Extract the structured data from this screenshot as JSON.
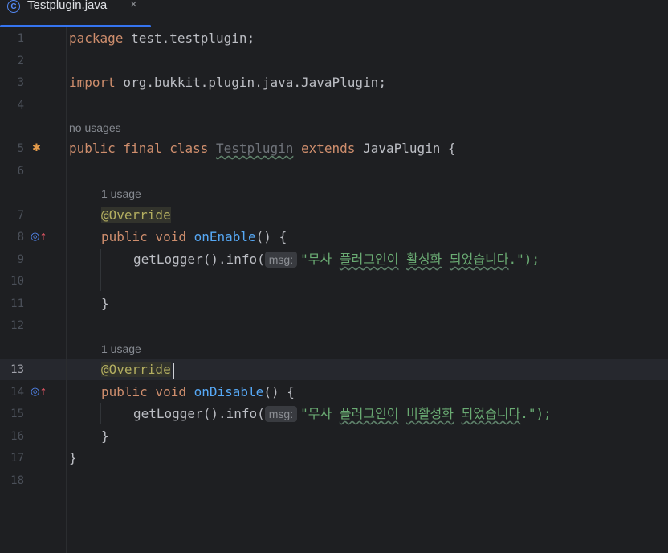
{
  "tab": {
    "icon": "class-icon",
    "icon_letter": "C",
    "label": "Testplugin.java",
    "close": "×"
  },
  "line_numbers": [
    "1",
    "2",
    "3",
    "4",
    "5",
    "6",
    "7",
    "8",
    "9",
    "10",
    "11",
    "12",
    "13",
    "14",
    "15",
    "16",
    "17",
    "18"
  ],
  "active_line": "13",
  "hints": {
    "no_usages": "no usages",
    "usage_enable": "1 usage",
    "usage_disable": "1 usage",
    "msg": "msg:"
  },
  "code": {
    "l1_kw": "package",
    "l1_rest": " test.testplugin;",
    "l3_kw": "import",
    "l3_rest": " org.bukkit.plugin.java.JavaPlugin;",
    "l5_kw1": "public final class",
    "l5_cls": "Testplugin",
    "l5_kw2": "extends",
    "l5_rest": " JavaPlugin {",
    "l7_ann": "@Override",
    "l8_kw": "public void",
    "l8_fn": "onEnable",
    "l8_rest": "() {",
    "l9_pre": "getLogger().info(",
    "l9_q1": "\"",
    "l9_w1": "무사",
    "l9_w2": "플러그인이",
    "l9_w3": "활성화",
    "l9_w4": "되었습니다",
    "l9_end": ".\");",
    "l11": "}",
    "l13_ann": "@Override",
    "l14_kw": "public void",
    "l14_fn": "onDisable",
    "l14_rest": "() {",
    "l15_pre": "getLogger().info(",
    "l15_q1": "\"",
    "l15_w1": "무사",
    "l15_w2": "플러그인이",
    "l15_w3": "비활성화",
    "l15_w4": "되었습니다",
    "l15_end": ".\");",
    "l16": "}",
    "l17": "}"
  },
  "colors": {
    "keyword": "#cf8e6d",
    "annotation": "#b3ae60",
    "function": "#56a8f5",
    "string": "#6aab73",
    "accent": "#3574f0"
  }
}
